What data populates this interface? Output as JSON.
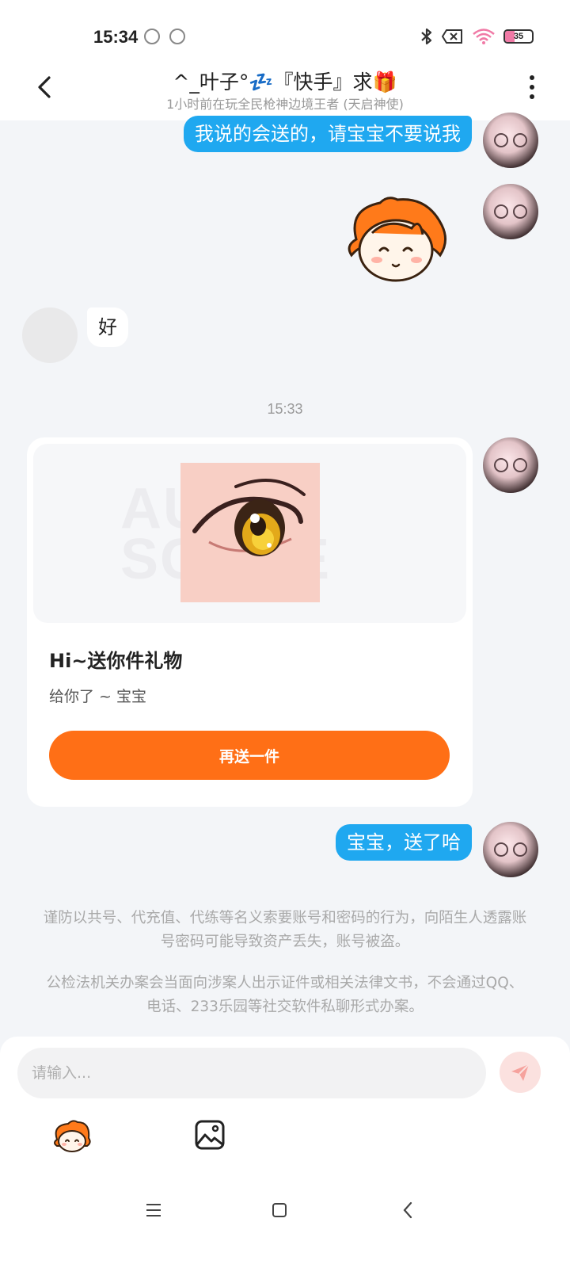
{
  "status_bar": {
    "time": "15:34",
    "battery_level": "35",
    "icons": [
      "bluetooth-icon",
      "sim-x-icon",
      "wifi-icon",
      "battery-icon"
    ]
  },
  "header": {
    "title": "^_叶子°💤『快手』求🎁",
    "subtitle": "1小时前在玩全民枪神边境王者 (天启神使)"
  },
  "messages": {
    "m1": "我说的会送的，请宝宝不要说我",
    "m2": "好",
    "timestamp": "15:33",
    "m4": "宝宝，送了哈"
  },
  "gift_card": {
    "watermark": "AUDR SCORE",
    "title": "Hi~送你件礼物",
    "description": "给你了 ~ 宝宝",
    "button_label": "再送一件"
  },
  "notices": {
    "n1": "谨防以共号、代充值、代练等名义索要账号和密码的行为，向陌生人透露账号密码可能导致资产丢失，账号被盗。",
    "n2": "公检法机关办案会当面向涉案人出示证件或相关法律文书，不会通过QQ、电话、233乐园等社交软件私聊形式办案。"
  },
  "input": {
    "placeholder": "请输入..."
  },
  "colors": {
    "my_bubble": "#1fa8f0",
    "accent_orange": "#ff6f16",
    "background": "#f3f5f8"
  }
}
